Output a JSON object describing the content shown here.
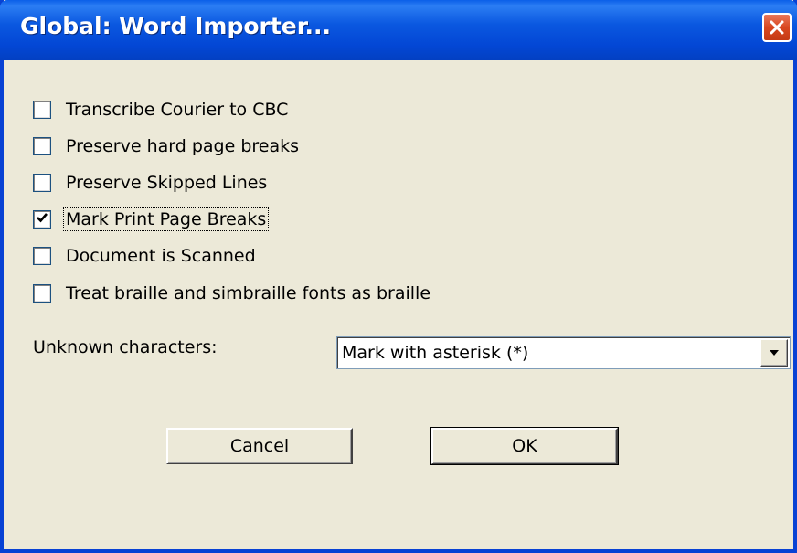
{
  "window": {
    "title": "Global: Word Importer...",
    "close_icon": "close-icon",
    "title_bar_color": "#0842d4",
    "close_button_color": "#d9471f"
  },
  "options": [
    {
      "label": "Transcribe Courier to CBC",
      "checked": false
    },
    {
      "label": "Preserve hard page breaks",
      "checked": false
    },
    {
      "label": "Preserve Skipped Lines",
      "checked": false
    },
    {
      "label": "Mark Print Page Breaks",
      "checked": true,
      "focused": true
    },
    {
      "label": "Document is Scanned",
      "checked": false
    },
    {
      "label": "Treat braille and simbraille fonts as braille",
      "checked": false
    }
  ],
  "unknown_characters": {
    "label": "Unknown characters:",
    "selected": "Mark with asterisk (*)",
    "arrow_icon": "dropdown-arrow-icon"
  },
  "buttons": {
    "cancel_label": "Cancel",
    "ok_label": "OK"
  }
}
